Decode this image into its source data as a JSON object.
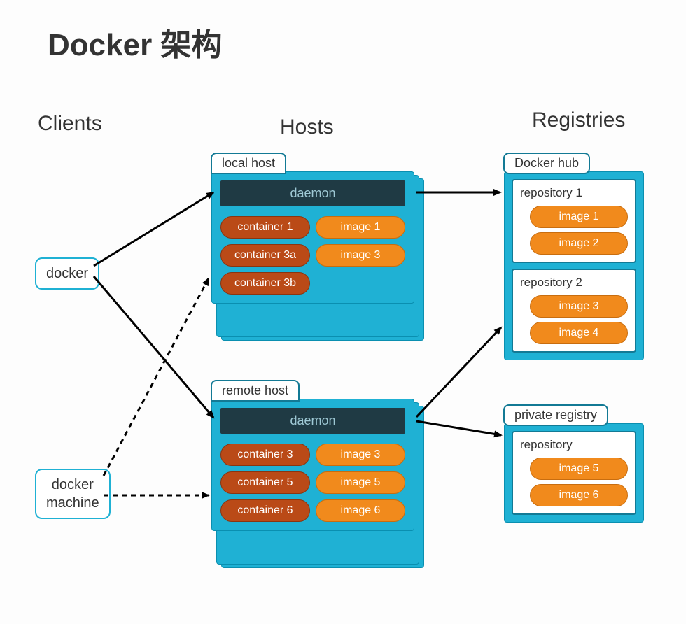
{
  "title": "Docker 架构",
  "columns": {
    "clients": "Clients",
    "hosts": "Hosts",
    "registries": "Registries"
  },
  "clients": {
    "docker": "docker",
    "machine": "docker\nmachine"
  },
  "hosts": {
    "local": {
      "tab": "local host",
      "daemon": "daemon",
      "containers": [
        "container 1",
        "container 3a",
        "container 3b"
      ],
      "images": [
        "image 1",
        "image 3"
      ]
    },
    "remote": {
      "tab": "remote host",
      "daemon": "daemon",
      "containers": [
        "container 3",
        "container 5",
        "container 6"
      ],
      "images": [
        "image 3",
        "image 5",
        "image 6"
      ]
    }
  },
  "registries": {
    "hub": {
      "tab": "Docker hub",
      "repos": [
        {
          "label": "repository 1",
          "images": [
            "image 1",
            "image 2"
          ]
        },
        {
          "label": "repository 2",
          "images": [
            "image 3",
            "image 4"
          ]
        }
      ]
    },
    "private": {
      "tab": "private registry",
      "repos": [
        {
          "label": "repository",
          "images": [
            "image 5",
            "image 6"
          ]
        }
      ]
    }
  }
}
